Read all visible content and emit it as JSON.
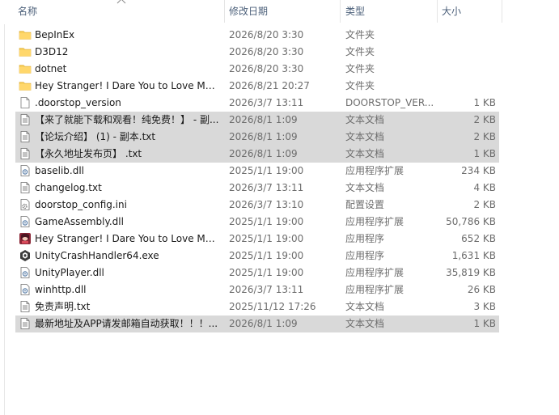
{
  "columns": {
    "name": "名称",
    "modified": "修改日期",
    "type": "类型",
    "size": "大小"
  },
  "files": [
    {
      "name": "BepInEx",
      "modified": "2026/8/20 3:30",
      "type": "文件夹",
      "size": "",
      "icon": "folder-icon",
      "selected": false
    },
    {
      "name": "D3D12",
      "modified": "2026/8/20 3:30",
      "type": "文件夹",
      "size": "",
      "icon": "folder-icon",
      "selected": false
    },
    {
      "name": "dotnet",
      "modified": "2026/8/20 3:30",
      "type": "文件夹",
      "size": "",
      "icon": "folder-icon",
      "selected": false
    },
    {
      "name": "Hey Stranger! I Dare You to Love Me...",
      "modified": "2026/8/21 20:27",
      "type": "文件夹",
      "size": "",
      "icon": "folder-icon",
      "selected": false
    },
    {
      "name": ".doorstop_version",
      "modified": "2026/3/7 13:11",
      "type": "DOORSTOP_VER...",
      "size": "1 KB",
      "icon": "file-icon",
      "selected": false
    },
    {
      "name": "【来了就能下载和观看！纯免费！】 - 副...",
      "modified": "2026/8/1 1:09",
      "type": "文本文档",
      "size": "2 KB",
      "icon": "text-file-icon",
      "selected": true
    },
    {
      "name": "【论坛介绍】 (1) - 副本.txt",
      "modified": "2026/8/1 1:09",
      "type": "文本文档",
      "size": "2 KB",
      "icon": "text-file-icon",
      "selected": true
    },
    {
      "name": "【永久地址发布页】 .txt",
      "modified": "2026/8/1 1:09",
      "type": "文本文档",
      "size": "1 KB",
      "icon": "text-file-icon",
      "selected": true
    },
    {
      "name": "baselib.dll",
      "modified": "2025/1/1 19:00",
      "type": "应用程序扩展",
      "size": "234 KB",
      "icon": "dll-icon",
      "selected": false
    },
    {
      "name": "changelog.txt",
      "modified": "2026/3/7 13:11",
      "type": "文本文档",
      "size": "4 KB",
      "icon": "text-file-icon",
      "selected": false
    },
    {
      "name": "doorstop_config.ini",
      "modified": "2026/3/7 13:10",
      "type": "配置设置",
      "size": "2 KB",
      "icon": "config-file-icon",
      "selected": false
    },
    {
      "name": "GameAssembly.dll",
      "modified": "2025/1/1 19:00",
      "type": "应用程序扩展",
      "size": "50,786 KB",
      "icon": "dll-icon",
      "selected": false
    },
    {
      "name": "Hey Stranger! I Dare You to Love Me...",
      "modified": "2025/1/1 19:00",
      "type": "应用程序",
      "size": "652 KB",
      "icon": "game-app-icon",
      "selected": false
    },
    {
      "name": "UnityCrashHandler64.exe",
      "modified": "2025/1/1 19:00",
      "type": "应用程序",
      "size": "1,631 KB",
      "icon": "unity-app-icon",
      "selected": false
    },
    {
      "name": "UnityPlayer.dll",
      "modified": "2025/1/1 19:00",
      "type": "应用程序扩展",
      "size": "35,819 KB",
      "icon": "dll-icon",
      "selected": false
    },
    {
      "name": "winhttp.dll",
      "modified": "2026/3/7 13:11",
      "type": "应用程序扩展",
      "size": "26 KB",
      "icon": "dll-icon",
      "selected": false
    },
    {
      "name": "免责声明.txt",
      "modified": "2025/11/12 17:26",
      "type": "文本文档",
      "size": "3 KB",
      "icon": "text-file-icon",
      "selected": false
    },
    {
      "name": "最新地址及APP请发邮箱自动获取！！！...",
      "modified": "2026/8/1 1:09",
      "type": "文本文档",
      "size": "1 KB",
      "icon": "text-file-icon",
      "selected": true
    }
  ],
  "colors": {
    "header_text": "#4c607a",
    "selection": "#d9d9d9",
    "folder": "#f8cf5a",
    "secondary_text": "#6d6d6d"
  }
}
